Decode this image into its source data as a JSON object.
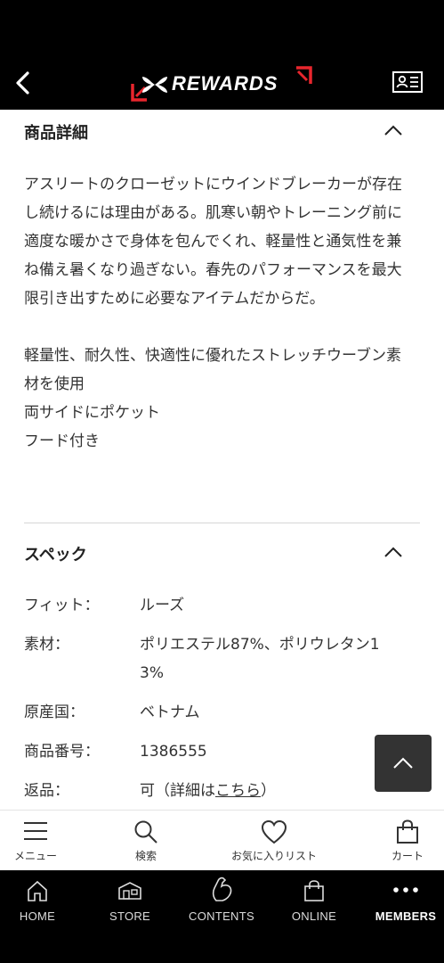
{
  "header": {
    "brand": "REWARDS",
    "brand_accent_color": "#e8262d",
    "back_icon": "chevron-left-icon",
    "card_icon": "member-card-icon"
  },
  "details": {
    "title": "商品詳細",
    "paragraphs": [
      "アスリートのクローゼットにウインドブレーカーが存在し続けるには理由がある。肌寒い朝やトレーニング前に適度な暖かさで身体を包んでくれ、軽量性と通気性を兼ね備え暑くなり過ぎない。春先のパフォーマンスを最大限引き出すために必要なアイテムだからだ。",
      "",
      "軽量性、耐久性、快適性に優れたストレッチウーブン素材を使用",
      "両サイドにポケット",
      "フード付き"
    ]
  },
  "spec": {
    "title": "スペック",
    "rows": [
      {
        "label": "フィット：",
        "value": "ルーズ"
      },
      {
        "label": "素材：",
        "value": "ポリエステル87%、ポリウレタン13%"
      },
      {
        "label": "原産国：",
        "value": "ベトナム"
      },
      {
        "label": "商品番号：",
        "value": "1386555"
      }
    ],
    "return": {
      "label": "返品：",
      "prefix": "可（詳細は",
      "link": "こちら",
      "suffix": "）"
    }
  },
  "toolbar": {
    "menu": "メニュー",
    "search": "検索",
    "favorites": "お気に入りリスト",
    "cart": "カート"
  },
  "bottom_nav": {
    "home": "HOME",
    "store": "STORE",
    "contents": "CONTENTS",
    "online": "ONLINE",
    "members": "MEMBERS"
  }
}
